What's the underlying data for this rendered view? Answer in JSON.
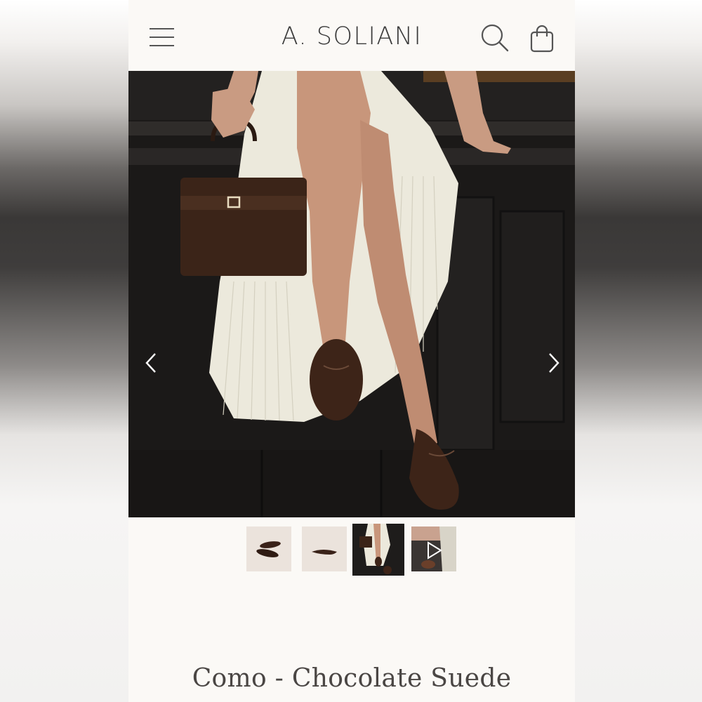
{
  "header": {
    "brand": "A. SOLIANI",
    "menu_icon": "hamburger-menu-icon",
    "search_icon": "search-icon",
    "cart_icon": "shopping-bag-icon"
  },
  "gallery": {
    "prev_icon": "chevron-left-icon",
    "next_icon": "chevron-right-icon",
    "thumbnails": [
      {
        "name": "thumbnail-pair-of-flats"
      },
      {
        "name": "thumbnail-single-flat-side"
      },
      {
        "name": "thumbnail-lifestyle",
        "selected": true
      },
      {
        "name": "thumbnail-video",
        "icon": "play-icon"
      }
    ]
  },
  "product": {
    "title": "Como - Chocolate Suede"
  },
  "colors": {
    "page_bg": "#fbf9f6",
    "text": "#4a4644",
    "suede_brown": "#3d2418"
  }
}
